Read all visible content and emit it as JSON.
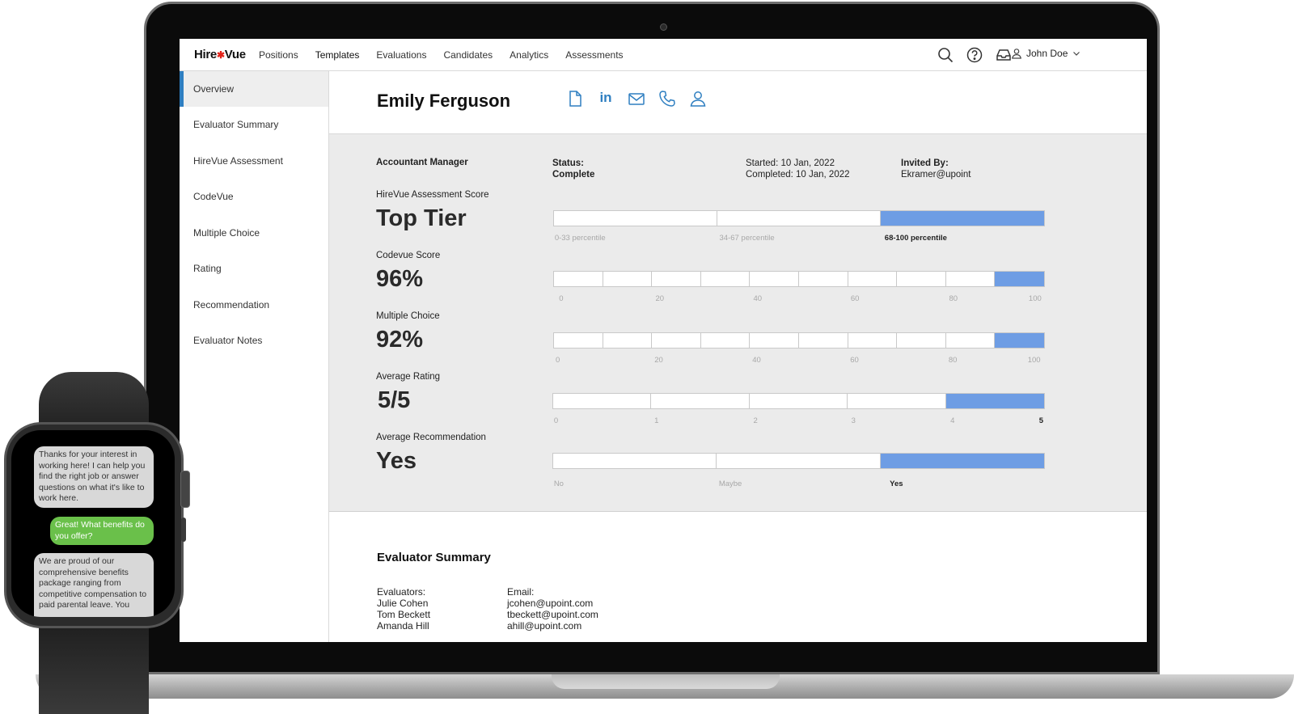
{
  "app": {
    "brand_prefix": "Hire",
    "brand_suffix": "Vue",
    "nav": [
      "Positions",
      "Templates",
      "Evaluations",
      "Candidates",
      "Analytics",
      "Assessments"
    ],
    "user_name": "John Doe",
    "icons": [
      "search-icon",
      "help-icon",
      "inbox-icon",
      "user-icon",
      "chevron-down-icon"
    ]
  },
  "sidebar": {
    "items": [
      "Overview",
      "Evaluator Summary",
      "HireVue Assessment",
      "CodeVue",
      "Multiple Choice",
      "Rating",
      "Recommendation",
      "Evaluator Notes"
    ],
    "active": "Overview"
  },
  "candidate": {
    "name": "Emily Ferguson",
    "contact_icons": [
      "document-icon",
      "linkedin-icon",
      "email-icon",
      "phone-icon",
      "profile-icon"
    ],
    "linkedin_text": "in"
  },
  "details": {
    "position": "Accountant Manager",
    "status_label": "Status:",
    "status_value": "Complete",
    "started": "Started: 10 Jan, 2022",
    "completed": "Completed: 10 Jan, 2022",
    "invited_label": "Invited By:",
    "invited_value": "Ekramer@upoint"
  },
  "scores": {
    "assessment": {
      "label": "HireVue Assessment Score",
      "value": "Top Tier",
      "ticks": [
        "0-33 percentile",
        "34-67 percentile",
        "68-100 percentile"
      ],
      "filled_segment": 3,
      "segments": 3
    },
    "codevue": {
      "label": "Codevue Score",
      "value": "96%",
      "ticks": [
        "0",
        "20",
        "40",
        "60",
        "80",
        "100"
      ],
      "level": 0.96,
      "segments": 10
    },
    "multiple_choice": {
      "label": "Multiple Choice",
      "value": "92%",
      "ticks": [
        "0",
        "20",
        "40",
        "60",
        "80",
        "100"
      ],
      "level": 0.92,
      "segments": 10
    },
    "rating": {
      "label": "Average Rating",
      "value": "5/5",
      "ticks": [
        "0",
        "1",
        "2",
        "3",
        "4",
        "5"
      ],
      "level": 5,
      "segments": 5
    },
    "recommendation": {
      "label": "Average Recommendation",
      "value": "Yes",
      "ticks": [
        "No",
        "Maybe",
        "Yes"
      ],
      "filled_segment": 3,
      "segments": 3
    },
    "fill_color": "#6e9de4"
  },
  "evaluator_summary": {
    "title": "Evaluator Summary",
    "evaluators_label": "Evaluators:",
    "email_label": "Email:",
    "rows": [
      {
        "name": "Julie Cohen",
        "email": "jcohen@upoint.com"
      },
      {
        "name": "Tom Beckett",
        "email": "tbeckett@upoint.com"
      },
      {
        "name": "Amanda Hill",
        "email": "ahill@upoint.com"
      }
    ]
  },
  "watch": {
    "messages": [
      {
        "from": "bot",
        "text": "Thanks for your interest in working here!  I can help you find the right job or answer questions on what it's like to work here."
      },
      {
        "from": "user",
        "text": "Great! What benefits do you offer?"
      },
      {
        "from": "bot",
        "text": "We are proud of our comprehensive benefits package ranging from competitive compensation to paid parental leave. You"
      }
    ]
  }
}
